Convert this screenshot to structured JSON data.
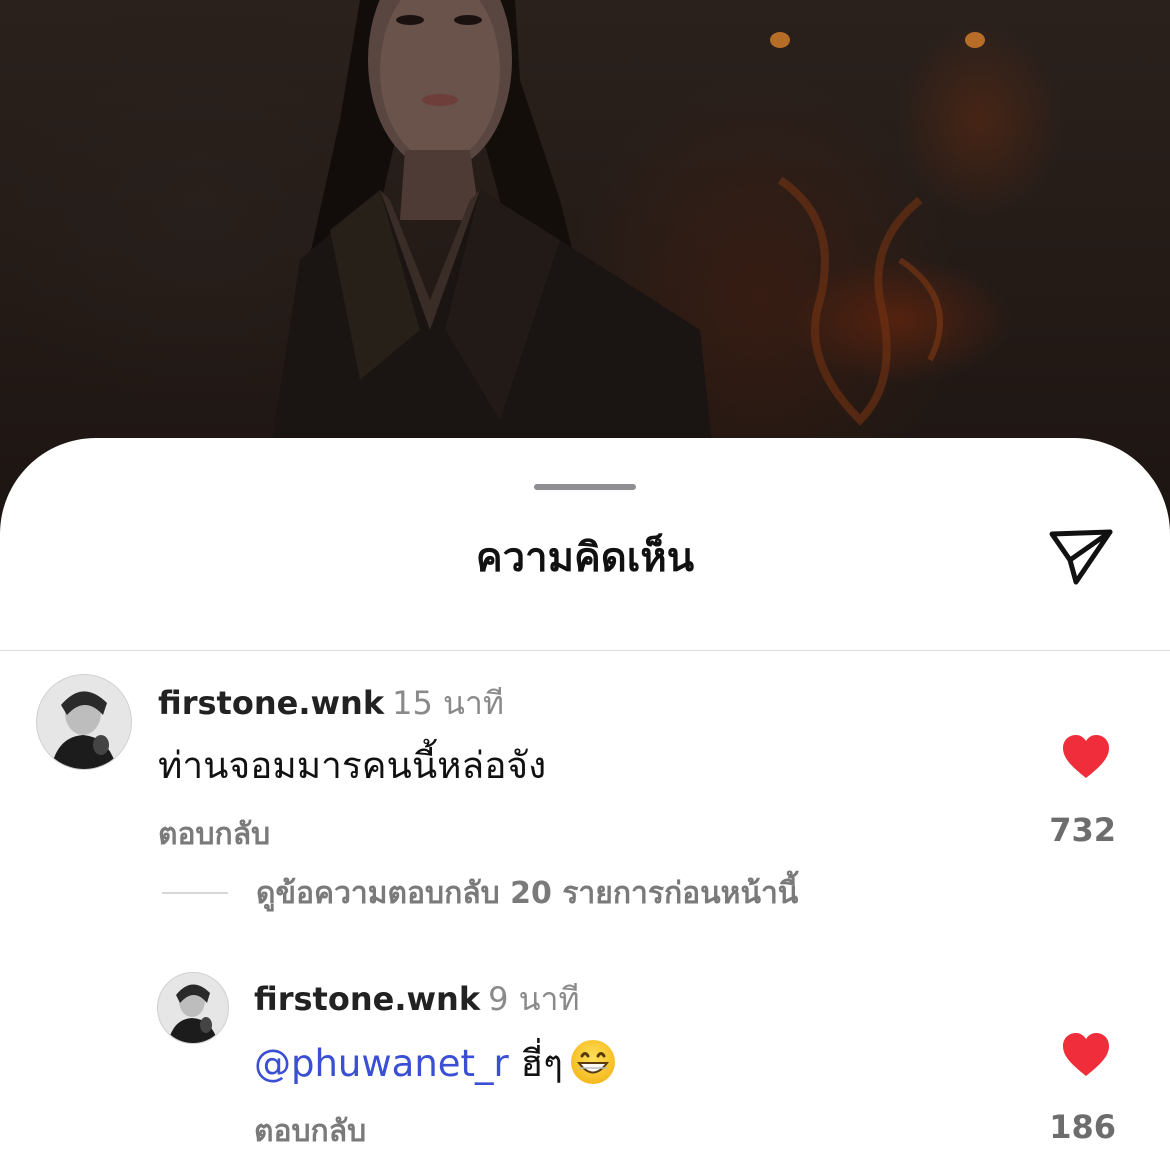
{
  "sheet": {
    "title": "ความคิดเห็น",
    "share_icon": "send-icon"
  },
  "comments": [
    {
      "username": "firstone.wnk",
      "time": "15 นาที",
      "text": "ท่านจอมมารคนนี้หล่อจัง",
      "reply_label": "ตอบกลับ",
      "likes": "732",
      "liked": true,
      "view_replies": "ดูข้อความตอบกลับ 20 รายการก่อนหน้านี้"
    }
  ],
  "replies": [
    {
      "username": "firstone.wnk",
      "time": "9 นาที",
      "mention": "@phuwanet_r",
      "text": "ฮี่ๆ",
      "emoji": "grinning-face-emoji",
      "reply_label": "ตอบกลับ",
      "likes": "186",
      "liked": true
    }
  ],
  "colors": {
    "heart": "#f02d3a",
    "mention": "#3b4fd4",
    "muted": "#7a7a7a"
  }
}
